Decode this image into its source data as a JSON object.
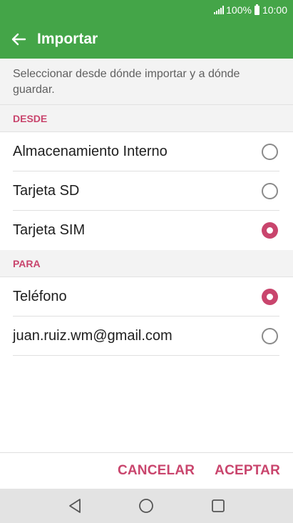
{
  "status_bar": {
    "battery": "100%",
    "time": "10:00"
  },
  "app_bar": {
    "title": "Importar"
  },
  "description": "Seleccionar desde dónde importar y a dónde guardar.",
  "from_section": {
    "header": "DESDE",
    "options": [
      {
        "label": "Almacenamiento Interno",
        "selected": false
      },
      {
        "label": "Tarjeta SD",
        "selected": false
      },
      {
        "label": "Tarjeta SIM",
        "selected": true
      }
    ]
  },
  "to_section": {
    "header": "PARA",
    "options": [
      {
        "label": "Teléfono",
        "selected": true
      },
      {
        "label": "juan.ruiz.wm@gmail.com",
        "selected": false
      }
    ]
  },
  "buttons": {
    "cancel": "CANCELAR",
    "accept": "ACEPTAR"
  },
  "colors": {
    "primary": "#44a548",
    "accent": "#c9456d"
  }
}
